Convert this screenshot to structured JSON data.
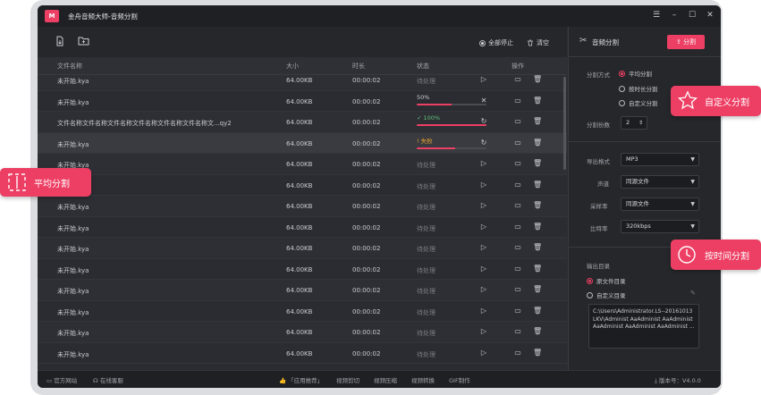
{
  "window": {
    "logo_text": "M",
    "title": "金舟音频大师-音频分割",
    "minimize": "–",
    "maximize": "☐",
    "close": "✕",
    "menu": "☰"
  },
  "toolbar": {
    "stop_all": "全部停止",
    "clear": "清空"
  },
  "table": {
    "headers": [
      "文件名称",
      "大小",
      "时长",
      "状态",
      "操作"
    ],
    "rows": [
      {
        "name": "未开始.kya",
        "size": "64.00KB",
        "duration": "00:00:02",
        "status": "待处理"
      },
      {
        "name": "未开始.kya",
        "size": "64.00KB",
        "duration": "00:00:02",
        "status": "50%"
      },
      {
        "name": "文件名称文件名称文件名称文件名称文件名称文件名称文...qy2",
        "size": "64.00KB",
        "duration": "00:00:02",
        "status": "100%"
      },
      {
        "name": "未开始.kya",
        "size": "64.00KB",
        "duration": "00:00:02",
        "status": "失败"
      },
      {
        "name": "未开始.kya",
        "size": "64.00KB",
        "duration": "00:00:02",
        "status": "待处理"
      },
      {
        "name": "未开始.kya",
        "size": "64.00KB",
        "duration": "00:00:02",
        "status": "待处理"
      },
      {
        "name": "未开始.kya",
        "size": "64.00KB",
        "duration": "00:00:02",
        "status": "待处理"
      },
      {
        "name": "未开始.kya",
        "size": "64.00KB",
        "duration": "00:00:02",
        "status": "待处理"
      },
      {
        "name": "未开始.kya",
        "size": "64.00KB",
        "duration": "00:00:02",
        "status": "待处理"
      },
      {
        "name": "未开始.kya",
        "size": "64.00KB",
        "duration": "00:00:02",
        "status": "待处理"
      },
      {
        "name": "未开始.kya",
        "size": "64.00KB",
        "duration": "00:00:02",
        "status": "待处理"
      },
      {
        "name": "未开始.kya",
        "size": "64.00KB",
        "duration": "00:00:02",
        "status": "待处理"
      },
      {
        "name": "未开始.kya",
        "size": "64.00KB",
        "duration": "00:00:02",
        "status": "待处理"
      },
      {
        "name": "未开始.kya",
        "size": "64.00KB",
        "duration": "00:00:02",
        "status": "待处理"
      }
    ],
    "progress": {
      "row_1": 0.5,
      "row_2": 1.0,
      "row_3": 0.55
    }
  },
  "bottom": {
    "website": "官方网站",
    "service": "在线客服",
    "recommend": "「应用推荐」",
    "video_cut": "视频剪切",
    "video_compress": "视频压缩",
    "video_convert": "视频转换",
    "gif": "GIF制作",
    "version": "版本号：V4.0.0"
  },
  "panel": {
    "title": "音频分割",
    "split_button": "分割",
    "split_mode_label": "分割方式",
    "mode_average": "平均分割",
    "mode_duration": "按时长分割",
    "mode_custom": "自定义分割",
    "count_label": "分割份数",
    "count_value": "2",
    "format_label": "导出格式",
    "format_value": "MP3",
    "channel_label": "声道",
    "channel_value": "同源文件",
    "sample_label": "采样率",
    "sample_value": "同源文件",
    "bitrate_label": "比特率",
    "bitrate_value": "320kbps",
    "output_label": "输出目录",
    "output_source": "原文件目录",
    "output_custom": "自定义目录",
    "path": "C:\\Users\\Administrator.LS--20161013LKV\\Administ AaAdminist AaAdminist AaAdminist AaAdminist AaAdminist ..."
  },
  "callouts": {
    "average": "平均分割",
    "custom": "自定义分割",
    "bytime": "按时间分割"
  },
  "colors": {
    "accent": "#ed3f64",
    "bg": "#2b2c31",
    "success": "#5fc07b",
    "warning": "#e0a030"
  }
}
